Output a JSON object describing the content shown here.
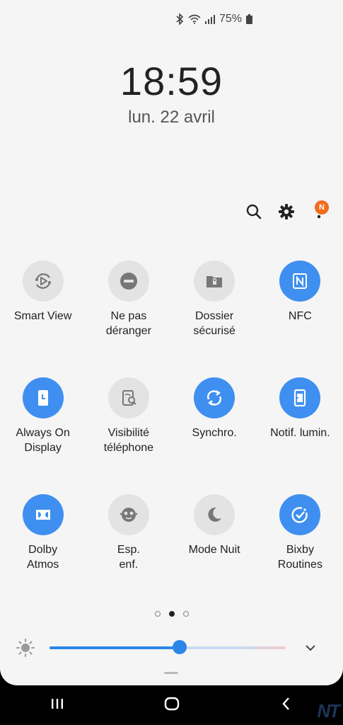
{
  "status": {
    "battery": "75%"
  },
  "clock": {
    "time": "18:59",
    "date": "lun. 22 avril"
  },
  "header": {
    "notification_badge": "N"
  },
  "tiles": [
    {
      "label": "Smart View",
      "icon": "smart-view-icon",
      "active": false
    },
    {
      "label": "Ne pas\ndéranger",
      "icon": "do-not-disturb-icon",
      "active": false
    },
    {
      "label": "Dossier\nsécurisé",
      "icon": "secure-folder-icon",
      "active": false
    },
    {
      "label": "NFC",
      "icon": "nfc-icon",
      "active": true
    },
    {
      "label": "Always On\nDisplay",
      "icon": "always-on-display-icon",
      "active": true
    },
    {
      "label": "Visibilité\ntéléphone",
      "icon": "phone-visibility-icon",
      "active": false
    },
    {
      "label": "Synchro.",
      "icon": "sync-icon",
      "active": true
    },
    {
      "label": "Notif. lumin.",
      "icon": "edge-lighting-icon",
      "active": true
    },
    {
      "label": "Dolby\nAtmos",
      "icon": "dolby-icon",
      "active": true
    },
    {
      "label": "Esp.\nenf.",
      "icon": "kids-mode-icon",
      "active": false
    },
    {
      "label": "Mode Nuit",
      "icon": "night-mode-icon",
      "active": false
    },
    {
      "label": "Bixby\nRoutines",
      "icon": "bixby-routines-icon",
      "active": true
    }
  ],
  "pagination": {
    "pages": 3,
    "current": 2
  },
  "brightness": {
    "level": 0.55
  },
  "colors": {
    "accent": "#3f8ff0",
    "badge": "#f26c1d"
  },
  "watermark": "NT"
}
